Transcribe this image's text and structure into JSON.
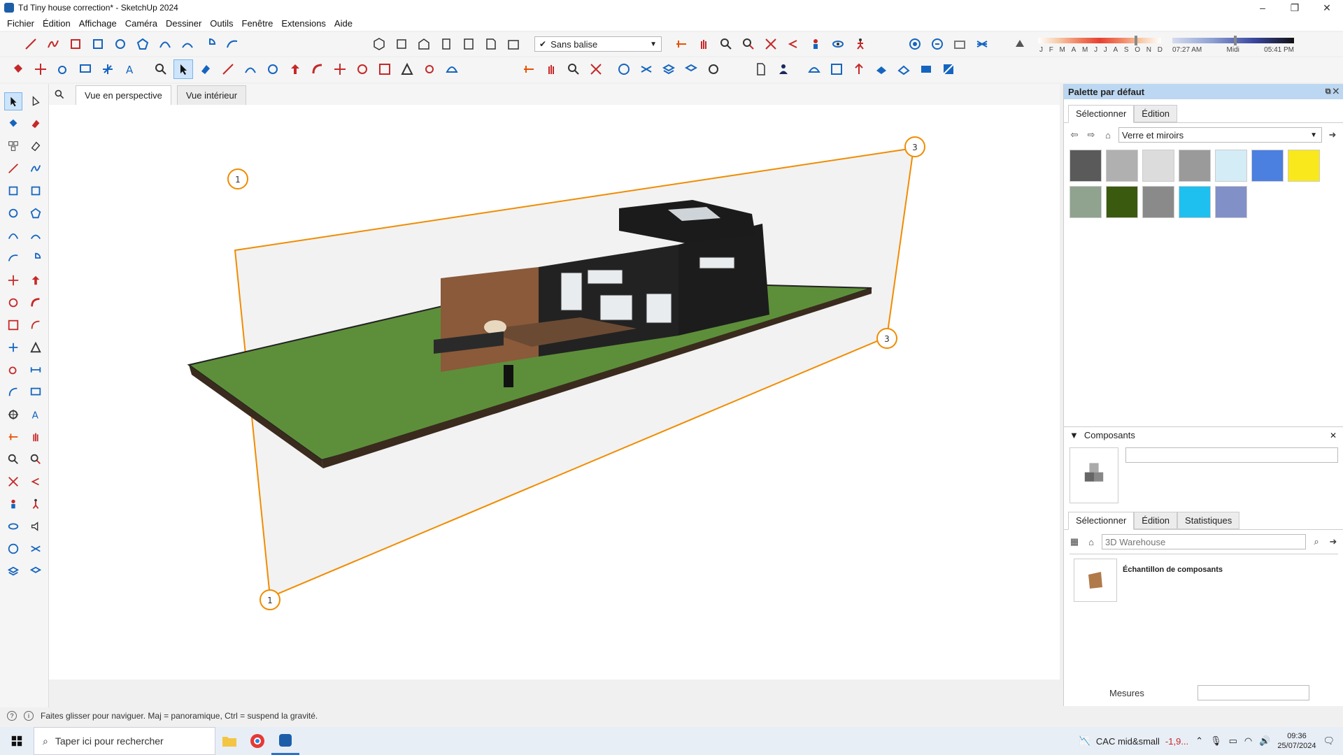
{
  "window": {
    "title": "Td Tiny house correction* - SketchUp 2024",
    "controls": [
      "–",
      "❐",
      "✕"
    ]
  },
  "menu": [
    "Fichier",
    "Édition",
    "Affichage",
    "Caméra",
    "Dessiner",
    "Outils",
    "Fenêtre",
    "Extensions",
    "Aide"
  ],
  "toolbar": {
    "tag_select": "Sans balise",
    "months": [
      "J",
      "F",
      "M",
      "A",
      "M",
      "J",
      "J",
      "A",
      "S",
      "O",
      "N",
      "D"
    ],
    "time_start": "07:27 AM",
    "time_mid": "Midi",
    "time_end": "05:41 PM"
  },
  "viewport": {
    "tabs": [
      "Vue en perspective",
      "Vue intérieur"
    ],
    "section_markers": [
      "1",
      "3",
      "3",
      "1"
    ]
  },
  "materials": {
    "header": "Palette par défaut",
    "tabs": [
      "Sélectionner",
      "Édition"
    ],
    "library": "Verre et miroirs",
    "swatch_colors": [
      "#5a5a5a",
      "#b0b0b0",
      "#dcdcdc",
      "#9a9a9a",
      "#d4ecf6",
      "#4b7fe0",
      "#f8e81c",
      "#8fa38f",
      "#3a5a10",
      "#8a8a8a",
      "#1ec0f0",
      "#8290c8"
    ]
  },
  "components": {
    "header": "Composants",
    "tabs": [
      "Sélectionner",
      "Édition",
      "Statistiques"
    ],
    "search_placeholder": "3D Warehouse",
    "item_label": "Échantillon de composants"
  },
  "measures": {
    "label": "Mesures"
  },
  "status": {
    "text": "Faites glisser pour naviguer. Maj = panoramique, Ctrl = suspend la gravité."
  },
  "taskbar": {
    "search_text": "Taper ici pour rechercher",
    "stock_name": "CAC mid&small",
    "stock_change": "-1,9...",
    "time": "09:36",
    "date": "25/07/2024"
  }
}
